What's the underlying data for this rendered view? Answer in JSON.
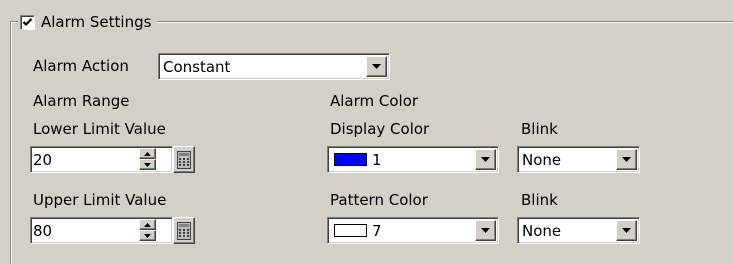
{
  "group": {
    "title": "Alarm Settings",
    "enabled": true
  },
  "alarm_action": {
    "label": "Alarm Action",
    "value": "Constant"
  },
  "alarm_range": {
    "heading": "Alarm Range",
    "lower": {
      "label": "Lower Limit Value",
      "value": "20"
    },
    "upper": {
      "label": "Upper Limit Value",
      "value": "80"
    }
  },
  "alarm_color": {
    "heading": "Alarm Color",
    "display": {
      "label": "Display Color",
      "value": "1",
      "swatch": "#0000ff",
      "blink_label": "Blink",
      "blink_value": "None"
    },
    "pattern": {
      "label": "Pattern Color",
      "value": "7",
      "swatch": "#ffffff",
      "blink_label": "Blink",
      "blink_value": "None"
    }
  },
  "icons": {
    "dropdown": "chevron-down-icon",
    "spin": "spin-arrows-icon",
    "keypad": "keypad-icon"
  }
}
